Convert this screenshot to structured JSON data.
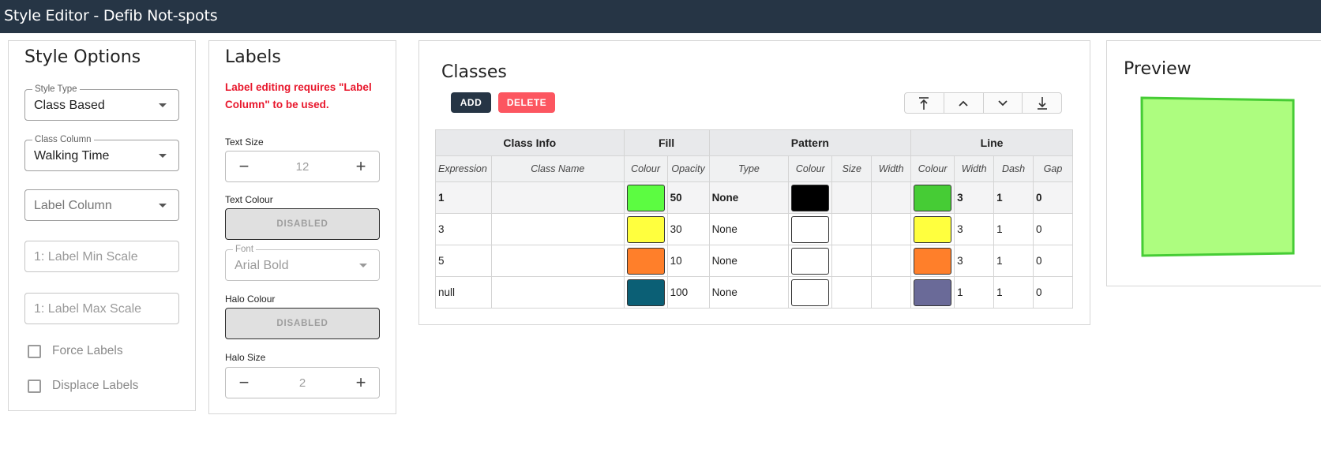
{
  "window": {
    "title": "Style Editor - Defib Not-spots"
  },
  "style_options": {
    "title": "Style Options",
    "style_type": {
      "label": "Style Type",
      "value": "Class Based"
    },
    "class_column": {
      "label": "Class Column",
      "value": "Walking Time"
    },
    "label_column": {
      "placeholder": "Label Column"
    },
    "label_min_scale": {
      "placeholder": "1: Label Min Scale"
    },
    "label_max_scale": {
      "placeholder": "1: Label Max Scale"
    },
    "force_labels": "Force Labels",
    "displace_labels": "Displace Labels"
  },
  "labels": {
    "title": "Labels",
    "warning": "Label editing requires \"Label Column\" to be used.",
    "text_size": {
      "label": "Text Size",
      "value": "12"
    },
    "text_colour": {
      "label": "Text Colour",
      "button": "DISABLED"
    },
    "font": {
      "label": "Font",
      "value": "Arial Bold"
    },
    "halo_colour": {
      "label": "Halo Colour",
      "button": "DISABLED"
    },
    "halo_size": {
      "label": "Halo Size",
      "value": "2"
    }
  },
  "classes": {
    "title": "Classes",
    "add_label": "ADD",
    "delete_label": "DELETE",
    "groups": {
      "class_info": "Class Info",
      "fill": "Fill",
      "pattern": "Pattern",
      "line": "Line"
    },
    "columns": {
      "expression": "Expression",
      "class_name": "Class Name",
      "fill_colour": "Colour",
      "fill_opacity": "Opacity",
      "pattern_type": "Type",
      "pattern_colour": "Colour",
      "pattern_size": "Size",
      "pattern_width": "Width",
      "line_colour": "Colour",
      "line_width": "Width",
      "line_dash": "Dash",
      "line_gap": "Gap"
    },
    "rows": [
      {
        "expression": "1",
        "class_name": "",
        "fill_colour": "#5cfc41",
        "opacity": "50",
        "pattern_type": "None",
        "pattern_colour": "#000000",
        "pattern_size": "",
        "pattern_width": "",
        "line_colour": "#46cc35",
        "line_width": "3",
        "dash": "1",
        "gap": "0"
      },
      {
        "expression": "3",
        "class_name": "",
        "fill_colour": "#ffff3e",
        "opacity": "30",
        "pattern_type": "None",
        "pattern_colour": "#ffffff",
        "pattern_size": "",
        "pattern_width": "",
        "line_colour": "#ffff3e",
        "line_width": "3",
        "dash": "1",
        "gap": "0"
      },
      {
        "expression": "5",
        "class_name": "",
        "fill_colour": "#ff7f2a",
        "opacity": "10",
        "pattern_type": "None",
        "pattern_colour": "#ffffff",
        "pattern_size": "",
        "pattern_width": "",
        "line_colour": "#ff7f2a",
        "line_width": "3",
        "dash": "1",
        "gap": "0"
      },
      {
        "expression": "null",
        "class_name": "",
        "fill_colour": "#0b5f75",
        "opacity": "100",
        "pattern_type": "None",
        "pattern_colour": "#ffffff",
        "pattern_size": "",
        "pattern_width": "",
        "line_colour": "#6a6a98",
        "line_width": "1",
        "dash": "1",
        "gap": "0"
      }
    ]
  },
  "preview": {
    "title": "Preview",
    "fill_colour": "#adfd7f",
    "line_colour": "#46cc35"
  },
  "colors": {
    "header_bg": "#263545",
    "add_button": "#263545",
    "delete_button": "#fc5660",
    "warning_text": "#e8172c"
  }
}
